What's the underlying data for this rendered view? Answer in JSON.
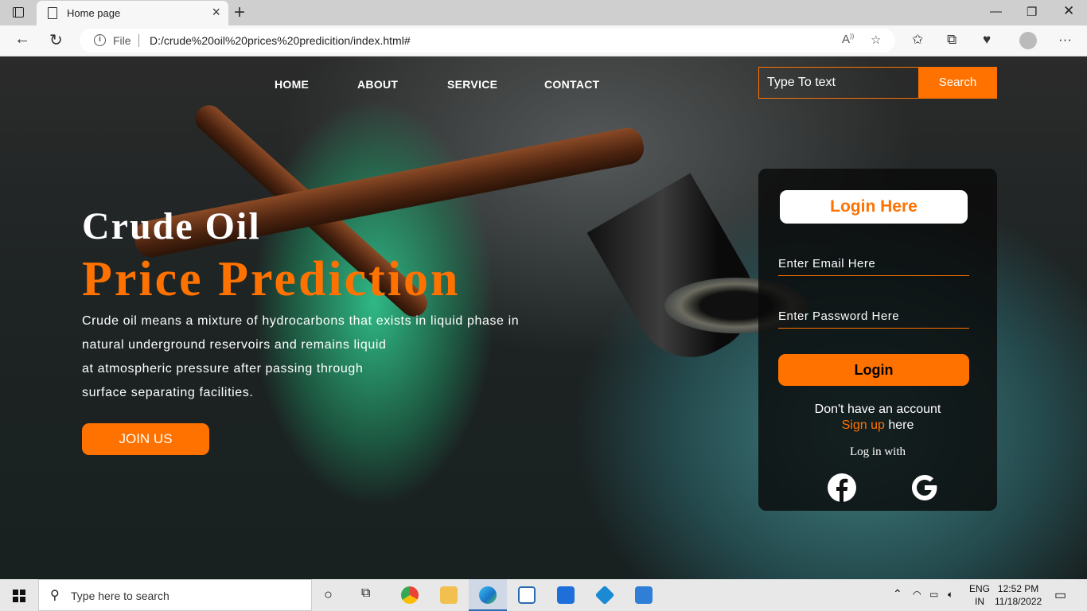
{
  "browser": {
    "tab_title": "Home page",
    "new_tab_icon": "+",
    "url_scheme_label": "File",
    "url": "D:/crude%20oil%20prices%20predicition/index.html#"
  },
  "nav": {
    "items": [
      "HOME",
      "ABOUT",
      "SERVICE",
      "CONTACT"
    ],
    "search_placeholder": "Type To text",
    "search_button": "Search"
  },
  "hero": {
    "title_line1": "Crude Oil",
    "title_line2": "Price Prediction",
    "paragraph_lines": [
      "Crude oil means a mixture of hydrocarbons that exists in liquid phase in",
      "natural underground reservoirs and remains liquid",
      "at atmospheric pressure after passing through",
      "surface separating facilities."
    ],
    "join_button": "JOIN US"
  },
  "login": {
    "title": "Login Here",
    "email_placeholder": "Enter Email Here",
    "password_placeholder": "Enter Password Here",
    "button": "Login",
    "no_account": "Don't have an account",
    "signup_link": "Sign up",
    "signup_suffix": " here",
    "login_with": "Log in with"
  },
  "taskbar": {
    "search_placeholder": "Type here to search",
    "lang_line1": "ENG",
    "lang_line2": "IN",
    "time": "12:52 PM",
    "date": "11/18/2022"
  },
  "colors": {
    "accent": "#ff7200",
    "card_bg": "rgba(10,10,10,0.82)"
  }
}
